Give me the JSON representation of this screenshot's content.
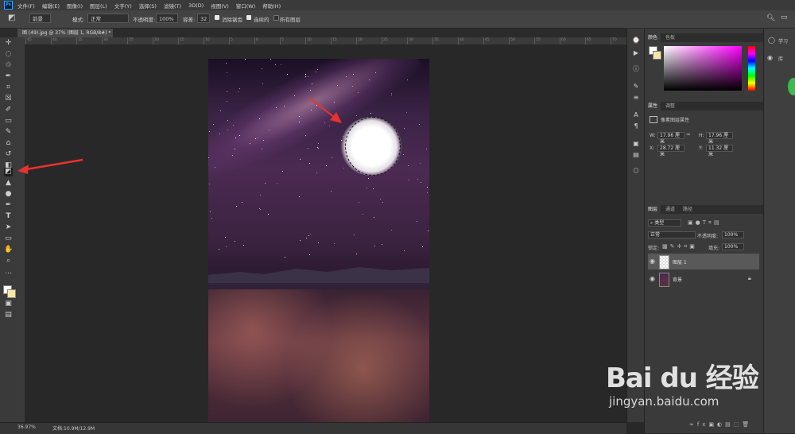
{
  "menu": {
    "logo": "Ps",
    "items": [
      "文件(F)",
      "编辑(E)",
      "图像(I)",
      "图层(L)",
      "文字(Y)",
      "选择(S)",
      "滤镜(T)",
      "3D(D)",
      "视图(V)",
      "窗口(W)",
      "帮助(H)"
    ]
  },
  "options": {
    "fill_source": "前景",
    "mode_label": "模式:",
    "mode_value": "正常",
    "opacity_label": "不透明度:",
    "opacity_value": "100%",
    "tolerance_label": "容差:",
    "tolerance_value": "32",
    "antialias_label": "消除锯齿",
    "contiguous_label": "连续的",
    "all_layers_label": "所有图层"
  },
  "document": {
    "tab_title": "图 (49).jpg @ 37% (图层 1, RGB/8#) *",
    "ruler_ticks": [
      "45",
      "40",
      "35",
      "30",
      "25",
      "20",
      "15",
      "10",
      "5",
      "0",
      "5",
      "10",
      "15",
      "20",
      "25",
      "30",
      "35",
      "40",
      "45",
      "50",
      "55",
      "60",
      "65",
      "70"
    ]
  },
  "status": {
    "zoom": "36.97%",
    "doc_size": "文档:10.9M/12.9M"
  },
  "color_panel": {
    "tabs": [
      "颜色",
      "色板"
    ],
    "colors": {
      "foreground": "#ffffff",
      "background": "#f5e6a8"
    }
  },
  "properties_panel": {
    "tabs": [
      "属性",
      "调整"
    ],
    "section_title": "像素图层属性",
    "w_label": "W:",
    "w_value": "17.96 厘米",
    "h_label": "H:",
    "h_value": "17.96 厘米",
    "x_label": "X:",
    "x_value": "28.72 厘米",
    "y_label": "Y:",
    "y_value": "11.32 厘米"
  },
  "layers_panel": {
    "tabs": [
      "图层",
      "通道",
      "路径"
    ],
    "filter_label": "类型",
    "blend_mode": "正常",
    "opacity_label": "不透明度:",
    "opacity_value": "100%",
    "lock_label": "锁定:",
    "fill_label": "填充:",
    "fill_value": "100%",
    "layers": [
      {
        "name": "图层 1"
      },
      {
        "name": "背景"
      }
    ]
  },
  "far_right": {
    "learn_label": "学习",
    "library_label": "库"
  },
  "watermark": {
    "brand": "Bai du 经验",
    "url": "jingyan.baidu.com"
  }
}
